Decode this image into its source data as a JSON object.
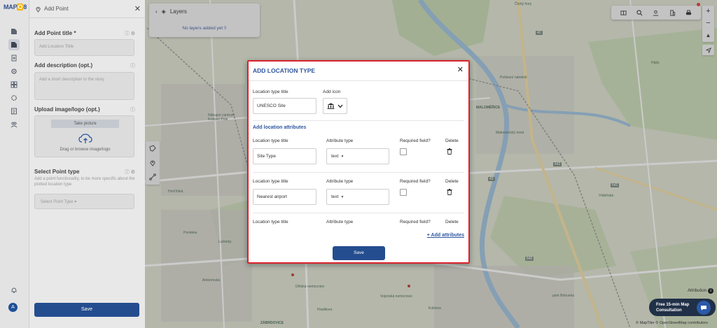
{
  "app": {
    "logo_text": "MAP",
    "logo_accent": "O",
    "logo_tail": "8"
  },
  "panel": {
    "title": "Add Point",
    "fields": {
      "point_title_label": "Add Point title *",
      "point_title_placeholder": "Add Location Tittle",
      "description_label": "Add description (opt.)",
      "description_placeholder": "Add a short description to the story",
      "upload_label": "Upload image/logo (opt.)",
      "take_picture": "Take picture",
      "drag_text": "Drag or browse image/logo",
      "point_type_label": "Select Point type",
      "point_type_help": "Add a point functionality, to be more specific about the plotted location type",
      "point_type_value": "Select Point Type"
    },
    "save_label": "Save",
    "avatar_initial": "A"
  },
  "layers": {
    "title": "Layers",
    "empty_text": "No layers added yet !!"
  },
  "modal": {
    "title": "ADD LOCATION TYPE",
    "location_type_title_label": "Location type title",
    "location_type_title_value": "UNESCO Site",
    "add_icon_label": "Add icon",
    "attributes_heading": "Add location attributes",
    "attributes": [
      {
        "title_label": "Location type title",
        "title_value": "Site Type",
        "type_label": "Attribute type",
        "type_value": "text",
        "required_label": "Required field?",
        "delete_label": "Delete"
      },
      {
        "title_label": "Location type title",
        "title_value": "Nearest airport",
        "type_label": "Attribute type",
        "type_value": "text",
        "required_label": "Required field?",
        "delete_label": "Delete"
      },
      {
        "title_label": "Location type title",
        "title_value": "",
        "type_label": "Attribute type",
        "type_value": "",
        "required_label": "Required field?",
        "delete_label": "Delete"
      }
    ],
    "add_attributes_label": "+ Add attributes",
    "save_label": "Save"
  },
  "map": {
    "labels": [
      {
        "text": "Čtvrtý hory"
      },
      {
        "text": "MALOMĚŘICE"
      },
      {
        "text": "Nákupní centrum Královo Pole"
      },
      {
        "text": "Lužánky"
      },
      {
        "text": "Ponávka"
      },
      {
        "text": "Hrnčířská"
      },
      {
        "text": "Dětská nemocnice"
      },
      {
        "text": "Vojenská nemocnice"
      },
      {
        "text": "Kuklova"
      },
      {
        "text": "Vídeňská"
      },
      {
        "text": "Hády"
      },
      {
        "text": "park Bohunka"
      },
      {
        "text": "ZÁBRDOVICE"
      },
      {
        "text": "Malomerický most"
      },
      {
        "text": "Poštovní náměstí"
      },
      {
        "text": "Antonínská"
      },
      {
        "text": "Hradilova"
      }
    ],
    "road_numbers": [
      "642",
      "642",
      "43",
      "42",
      "640"
    ]
  },
  "footer": {
    "attribution": "Attribution",
    "consult_line1": "Free 15-min Map",
    "consult_line2": "Consultation",
    "copyright": "© MapTiler © OpenStreetMap contributors"
  },
  "colors": {
    "accent": "#244d8f",
    "modal_border": "#d9232d",
    "heading_blue": "#2f56a0"
  },
  "icons": {
    "rail": [
      "edit-icon",
      "edit-active-icon",
      "add-doc-icon",
      "settings-icon",
      "layers-grid-icon",
      "gear-icon",
      "list-icon",
      "users-icon",
      "bell-icon"
    ],
    "toolbar": [
      "map-book-icon",
      "search-icon",
      "user-pin-icon",
      "building-icon",
      "print-icon"
    ],
    "modal_location_icon": "museum-icon"
  }
}
